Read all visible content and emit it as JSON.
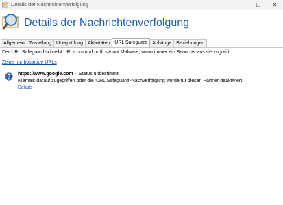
{
  "window": {
    "title": "Details der Nachrichtenverfolgung",
    "minimize_glyph": "—",
    "maximize_glyph": "☐",
    "close_glyph": "✕"
  },
  "header": {
    "title": "Details der Nachrichtenverfolgung",
    "icon": "envelope-magnifier-icon"
  },
  "tabs": [
    {
      "label": "Allgemein",
      "active": false
    },
    {
      "label": "Zustellung",
      "active": false
    },
    {
      "label": "Überprüfung",
      "active": false
    },
    {
      "label": "Aktivitäten",
      "active": false
    },
    {
      "label": "URL Safeguard",
      "active": true
    },
    {
      "label": "Anhänge",
      "active": false
    },
    {
      "label": "Beziehungen",
      "active": false
    }
  ],
  "main": {
    "description": "Der URL Safeguard schreibt URLs um und prüft sie auf Malware, wann immer ein Benutzer aus sie zugreift.",
    "filter_link": "Zeige nur bösartige URLs",
    "entries": [
      {
        "icon": "info-icon",
        "url": "https://www.google.com",
        "separator": " -  ",
        "status": "Status unbestimmt",
        "message": "Niemals darauf zugegriffen oder die 'URL Safeguard'-Nachverfolgung wurde für diesen Partner deaktiviert.",
        "details_link": "Details"
      }
    ]
  },
  "colors": {
    "title_blue": "#1f5fa6",
    "link_blue": "#0b4fa3",
    "info_icon_blue": "#2f5aa8"
  }
}
